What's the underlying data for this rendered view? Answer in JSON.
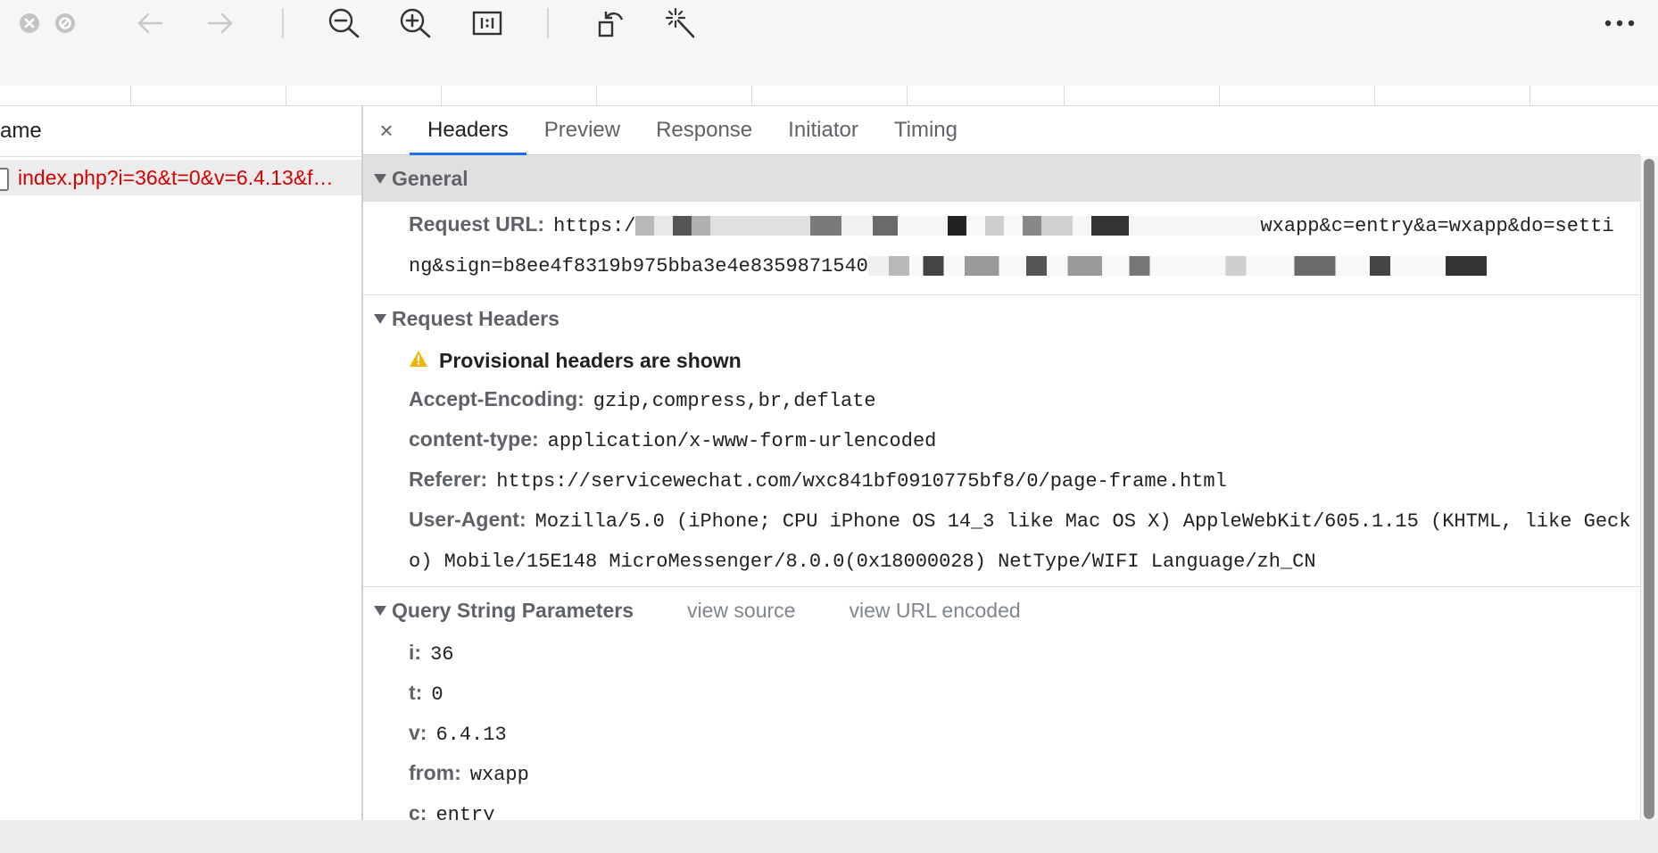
{
  "toolbar": {
    "icons": [
      "close-circle-icon",
      "stop-circle-icon",
      "back-arrow-icon",
      "forward-arrow-icon",
      "zoom-out-icon",
      "zoom-in-icon",
      "actual-size-icon",
      "rotate-icon",
      "magic-wand-icon",
      "more-icon"
    ],
    "more_label": "···"
  },
  "name_panel": {
    "header": "ame",
    "requests": [
      {
        "name": "index.php?i=36&t=0&v=6.4.13&f…",
        "status_color": "#d50000"
      }
    ]
  },
  "tabs": {
    "close_label": "×",
    "items": [
      "Headers",
      "Preview",
      "Response",
      "Initiator",
      "Timing"
    ],
    "active": "Headers"
  },
  "general": {
    "title": "General",
    "request_url_label": "Request URL:",
    "request_url_prefix": "https:/",
    "request_url_mid": "wxapp&c=entry&a=wxapp&do=setti",
    "request_url_line2": "ng&sign=b8ee4f8319b975bba3e4e8359871540"
  },
  "request_headers": {
    "title": "Request Headers",
    "provisional": "Provisional headers are shown",
    "items": [
      {
        "key": "Accept-Encoding:",
        "value": "gzip,compress,br,deflate"
      },
      {
        "key": "content-type:",
        "value": "application/x-www-form-urlencoded"
      },
      {
        "key": "Referer:",
        "value": "https://servicewechat.com/wxc841bf0910775bf8/0/page-frame.html"
      },
      {
        "key": "User-Agent:",
        "value": "Mozilla/5.0 (iPhone; CPU iPhone OS 14_3 like Mac OS X) AppleWebKit/605.1.15 (KHTML, like Gecko) Mobile/15E148 MicroMessenger/8.0.0(0x18000028) NetType/WIFI Language/zh_CN"
      }
    ]
  },
  "query": {
    "title": "Query String Parameters",
    "view_source": "view source",
    "view_encoded": "view URL encoded",
    "params": [
      {
        "key": "i:",
        "value": "36"
      },
      {
        "key": "t:",
        "value": "0"
      },
      {
        "key": "v:",
        "value": "6.4.13"
      },
      {
        "key": "from:",
        "value": "wxapp"
      },
      {
        "key": "c:",
        "value": "entry"
      }
    ]
  },
  "colors": {
    "accent": "#1a73e8",
    "error_red": "#d50000",
    "warning_yellow": "#f4b400"
  }
}
